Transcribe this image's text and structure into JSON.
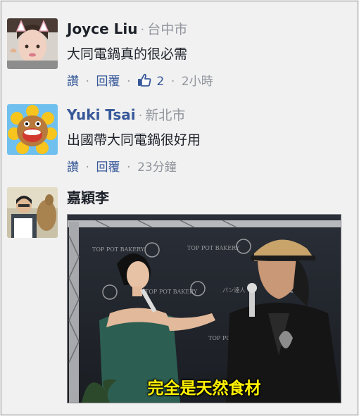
{
  "comments": [
    {
      "name": "Joyce Liu",
      "location": "台中市",
      "text": "大同電鍋真的很必需",
      "actions": {
        "read": "讚",
        "reply": "回覆",
        "likes": "2",
        "time": "2小時"
      }
    },
    {
      "name": "Yuki Tsai",
      "location": "新北市",
      "text": "出國帶大同電鍋很好用",
      "actions": {
        "read": "讚",
        "reply": "回覆",
        "time": "23分鐘"
      }
    },
    {
      "name": "嘉穎李",
      "photo": {
        "caption": "完全是天然食材",
        "backdrop_brand": "TOP POT BAKERY",
        "backdrop_sub": "パン達人"
      }
    }
  ],
  "separator": "·",
  "colors": {
    "link": "#365899",
    "meta": "#90949c",
    "text": "#1d2129"
  }
}
